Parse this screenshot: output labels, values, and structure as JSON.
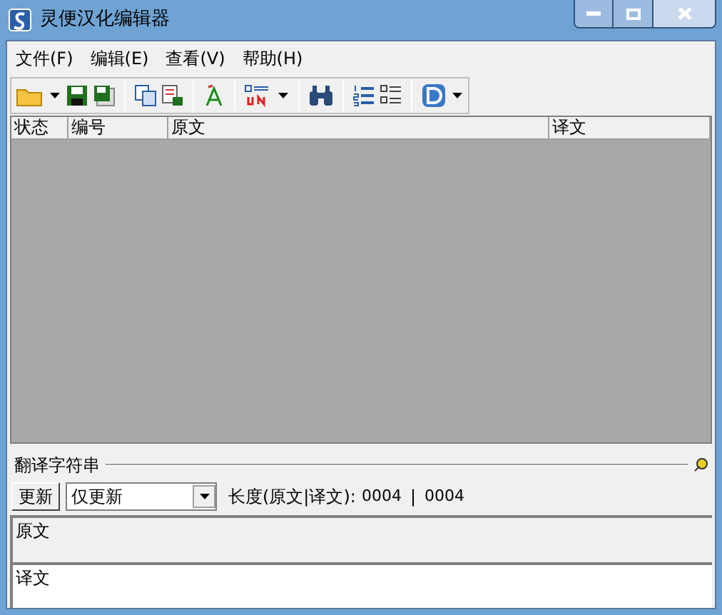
{
  "window": {
    "title": "灵便汉化编辑器"
  },
  "menu": [
    "文件(F)",
    "编辑(E)",
    "查看(V)",
    "帮助(H)"
  ],
  "table": {
    "columns": [
      "状态",
      "编号",
      "原文",
      "译文"
    ]
  },
  "panel": {
    "title": "翻译字符串",
    "update_button": "更新",
    "mode_select": {
      "value": "仅更新"
    },
    "length_label": "长度(原文|译文):",
    "source_length": "0004",
    "separator": "|",
    "target_length": "0004"
  },
  "source_field": {
    "value": "原文"
  },
  "target_field": {
    "value": "译文"
  }
}
